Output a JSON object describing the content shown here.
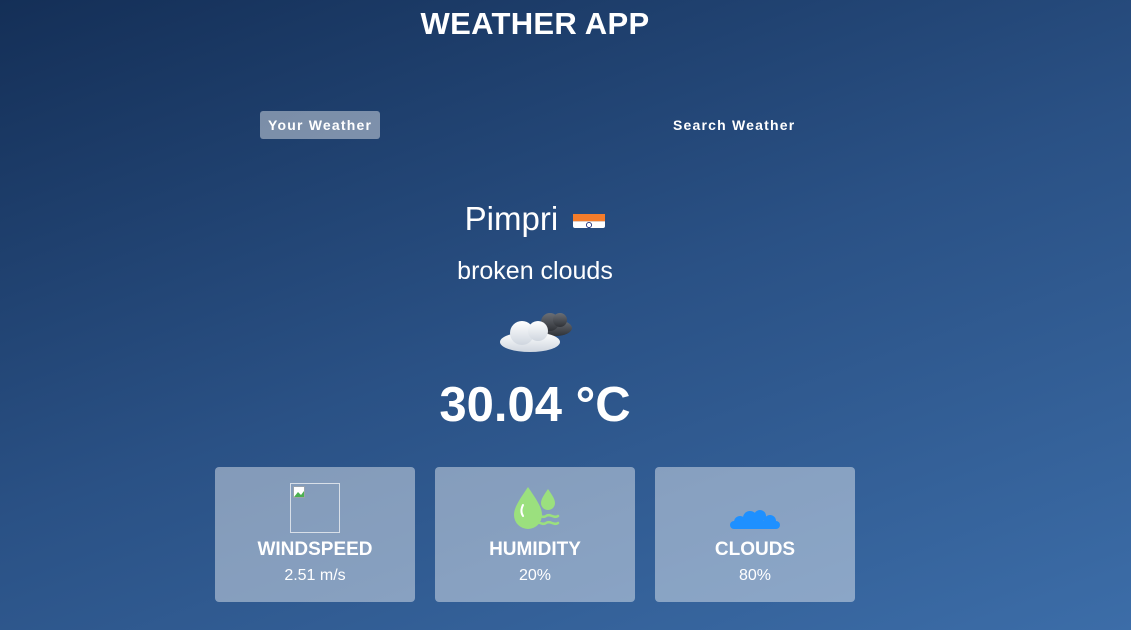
{
  "app": {
    "title": "WEATHER APP"
  },
  "tabs": [
    {
      "label": "Your Weather",
      "active": true
    },
    {
      "label": "Search Weather",
      "active": false
    }
  ],
  "weather": {
    "city": "Pimpri",
    "country_flag": "india-flag",
    "description": "broken clouds",
    "icon": "broken-clouds-icon",
    "temperature": "30.04 °C"
  },
  "stats": [
    {
      "title": "WINDSPEED",
      "value": "2.51 m/s",
      "icon": "broken-image-icon"
    },
    {
      "title": "HUMIDITY",
      "value": "20%",
      "icon": "humidity-icon"
    },
    {
      "title": "CLOUDS",
      "value": "80%",
      "icon": "clouds-icon"
    }
  ],
  "colors": {
    "background_top": "#142f57",
    "background_bottom": "#3c6da8",
    "humidity_icon": "#9be07e",
    "clouds_icon": "#1e90ff"
  }
}
